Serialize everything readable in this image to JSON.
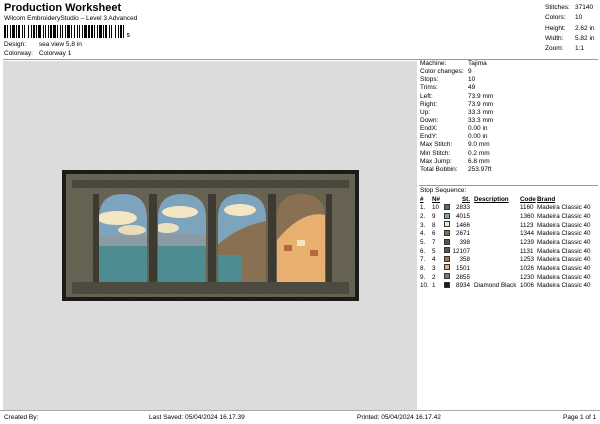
{
  "header": {
    "title": "Production Worksheet",
    "subtitle": "Wilcom EmbroideryStudio – Level 3 Advanced",
    "barcode_mark": "5"
  },
  "meta": {
    "design_label": "Design:",
    "design_value": "sea view 5,8 in",
    "colorway_label": "Colorway:",
    "colorway_value": "Colorway 1"
  },
  "stats": [
    {
      "label": "Stitches:",
      "value": "37140"
    },
    {
      "label": "Colors:",
      "value": "10"
    },
    {
      "label": "Height:",
      "value": "2.62 in"
    },
    {
      "label": "Width:",
      "value": "5.82 in"
    },
    {
      "label": "Zoom:",
      "value": "1:1"
    }
  ],
  "info": [
    {
      "label": "Machine:",
      "value": "Tajima"
    },
    {
      "label": "Color changes:",
      "value": "9"
    },
    {
      "label": "Stops:",
      "value": "10"
    },
    {
      "label": "Trims:",
      "value": "49"
    },
    {
      "label": "Left:",
      "value": "73.9 mm"
    },
    {
      "label": "Right:",
      "value": "73.9 mm"
    },
    {
      "label": "Up:",
      "value": "33.3 mm"
    },
    {
      "label": "Down:",
      "value": "33.3 mm"
    },
    {
      "label": "EndX:",
      "value": "0.00 in"
    },
    {
      "label": "EndY:",
      "value": "0.00 in"
    },
    {
      "label": "Max Stitch:",
      "value": "9.0 mm"
    },
    {
      "label": "Min Stitch:",
      "value": "0.2 mm"
    },
    {
      "label": "Max Jump:",
      "value": "6.8 mm"
    },
    {
      "label": "Total Bobbin:",
      "value": "253.97ft"
    }
  ],
  "sequence": {
    "title": "Stop Sequence:",
    "headers": {
      "num": "#",
      "n": "N#",
      "st": "St.",
      "desc": "Description",
      "code": "Code",
      "brand": "Brand"
    },
    "rows": [
      {
        "num": "1.",
        "n": "10",
        "color": "#4a6f8a",
        "st": "2833",
        "desc": "",
        "code": "1160",
        "brand": "Madeira Classic 40"
      },
      {
        "num": "2.",
        "n": "9",
        "color": "#7ea3bd",
        "st": "4015",
        "desc": "",
        "code": "1360",
        "brand": "Madeira Classic 40"
      },
      {
        "num": "3.",
        "n": "8",
        "color": "#f3e6c2",
        "st": "1466",
        "desc": "",
        "code": "1123",
        "brand": "Madeira Classic 40"
      },
      {
        "num": "4.",
        "n": "6",
        "color": "#8a7052",
        "st": "2671",
        "desc": "",
        "code": "1344",
        "brand": "Madeira Classic 40"
      },
      {
        "num": "5.",
        "n": "7",
        "color": "#555555",
        "st": "398",
        "desc": "",
        "code": "1239",
        "brand": "Madeira Classic 40"
      },
      {
        "num": "6.",
        "n": "5",
        "color": "#4d5a66",
        "st": "12107",
        "desc": "",
        "code": "1131",
        "brand": "Madeira Classic 40"
      },
      {
        "num": "7.",
        "n": "4",
        "color": "#b86a3f",
        "st": "358",
        "desc": "",
        "code": "1253",
        "brand": "Madeira Classic 40"
      },
      {
        "num": "8.",
        "n": "3",
        "color": "#e8b06e",
        "st": "1501",
        "desc": "",
        "code": "1026",
        "brand": "Madeira Classic 40"
      },
      {
        "num": "9.",
        "n": "2",
        "color": "#6b7e8c",
        "st": "2855",
        "desc": "",
        "code": "1230",
        "brand": "Madeira Classic 40"
      },
      {
        "num": "10.",
        "n": "1",
        "color": "#1a1a1a",
        "st": "8934",
        "desc": "Diamond Black",
        "code": "1006",
        "brand": "Madeira Classic 40"
      }
    ]
  },
  "footer": {
    "created_by": "Created By:",
    "last_saved": "Last Saved: 05/04/2024 16.17.39",
    "printed": "Printed: 05/04/2024 16.17.42",
    "page": "Page 1 of 1"
  }
}
